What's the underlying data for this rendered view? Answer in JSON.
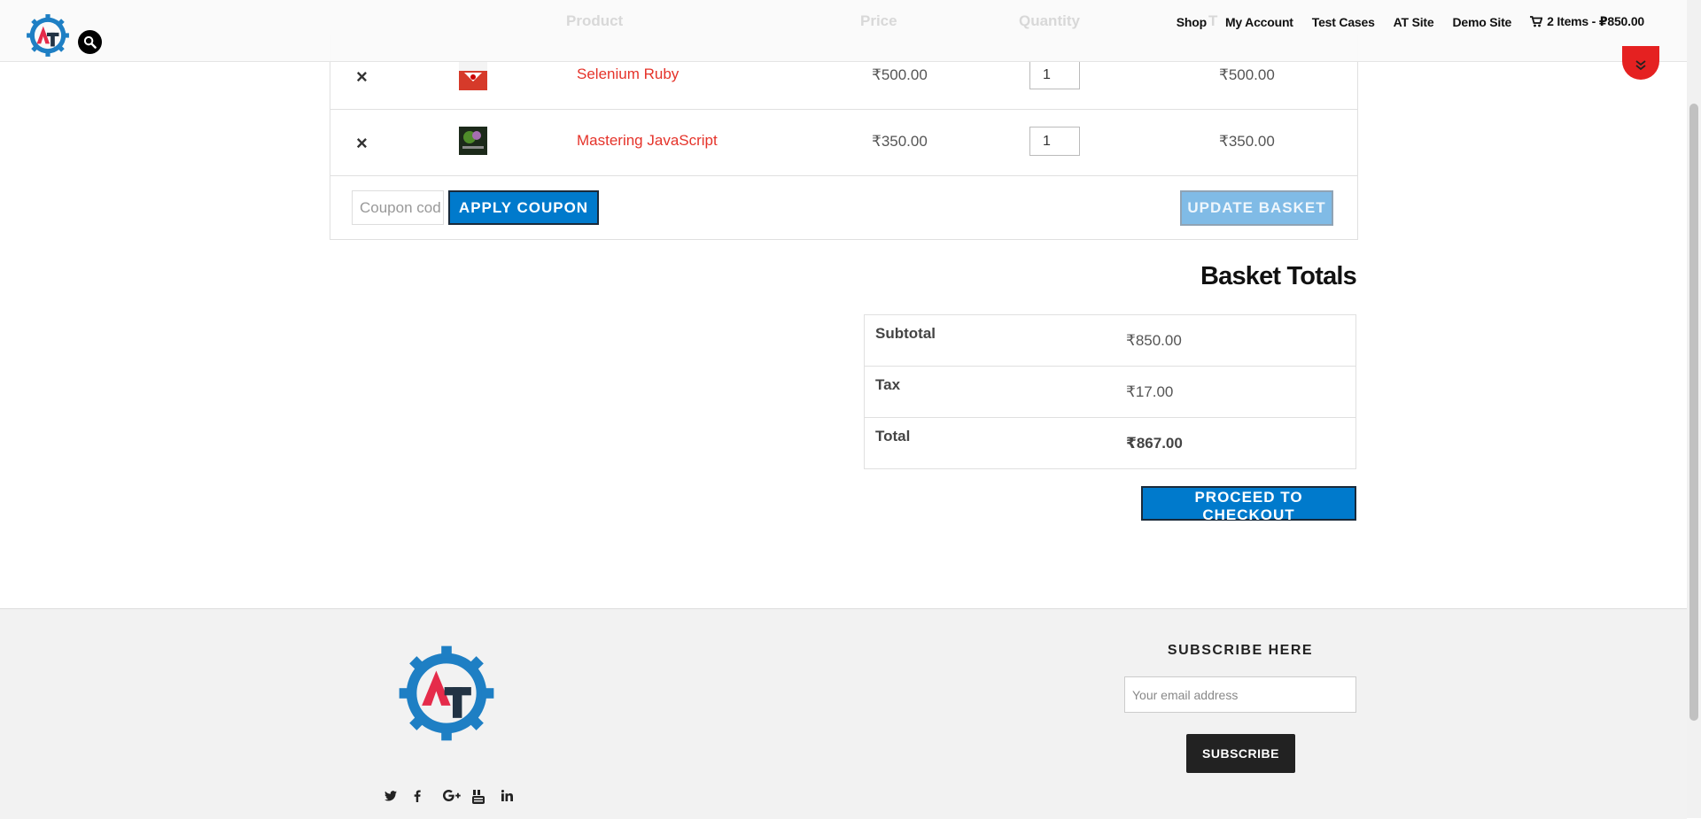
{
  "header": {
    "table_headers": [
      "Product",
      "Price",
      "Quantity",
      "T"
    ],
    "nav": [
      {
        "label": "Shop"
      },
      {
        "label": "My Account"
      },
      {
        "label": "Test Cases"
      },
      {
        "label": "AT Site"
      },
      {
        "label": "Demo Site"
      }
    ],
    "cart_summary": "2 Items - ₽850.00"
  },
  "cart": {
    "items": [
      {
        "remove": "×",
        "name": "Selenium Ruby",
        "price": "₹500.00",
        "quantity": "1",
        "subtotal": "₹500.00"
      },
      {
        "remove": "×",
        "name": "Mastering JavaScript",
        "price": "₹350.00",
        "quantity": "1",
        "subtotal": "₹350.00"
      }
    ],
    "coupon_placeholder": "Coupon code",
    "apply_label": "APPLY COUPON",
    "update_label": "UPDATE BASKET"
  },
  "totals": {
    "title": "Basket Totals",
    "rows": [
      {
        "label": "Subtotal",
        "value": "₹850.00"
      },
      {
        "label": "Tax",
        "value": "₹17.00"
      },
      {
        "label": "Total",
        "value": "₹867.00"
      }
    ],
    "checkout_label": "PROCEED TO CHECKOUT"
  },
  "footer": {
    "subscribe_title": "SUBSCRIBE HERE",
    "email_placeholder": "Your email address",
    "subscribe_label": "SUBSCRIBE",
    "social_icons": [
      "twitter-icon",
      "facebook-icon",
      "google-plus-icon",
      "youtube-icon",
      "linkedin-icon"
    ]
  },
  "colors": {
    "accent_blue": "#007acc",
    "link_red": "#e5332a",
    "scroll_top_red": "#e52121"
  }
}
